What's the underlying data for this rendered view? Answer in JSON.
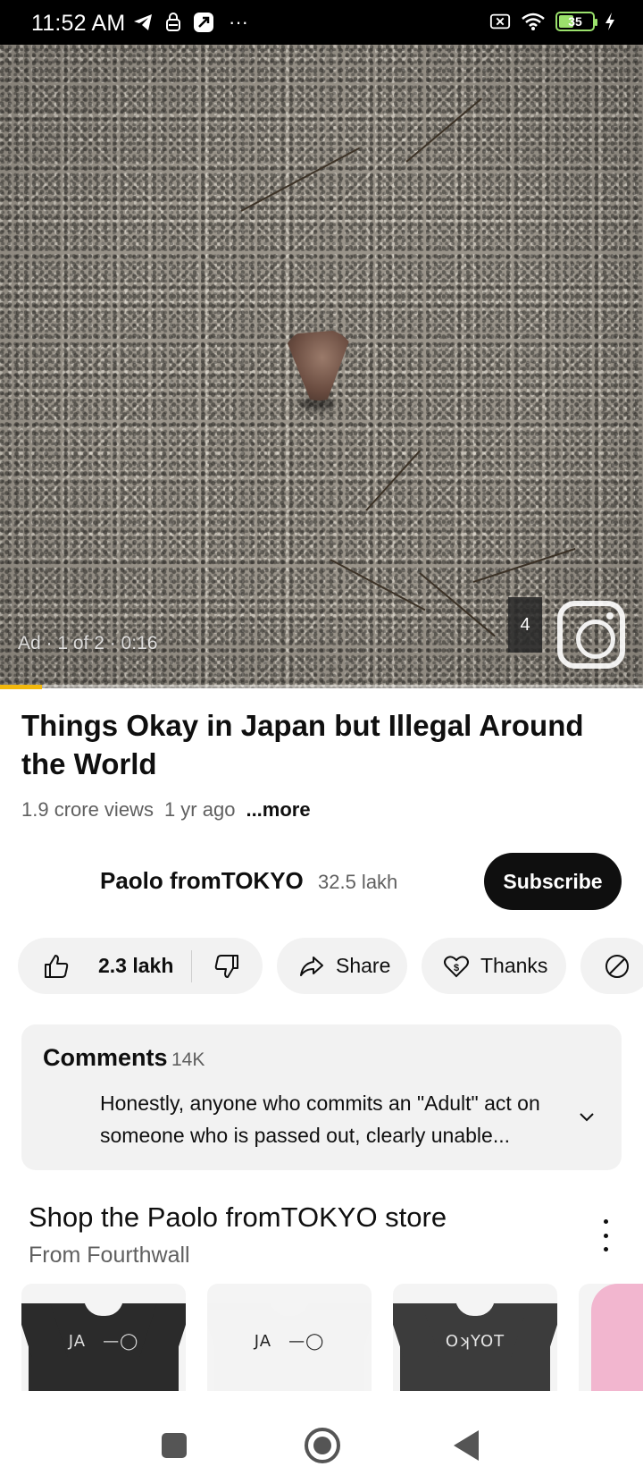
{
  "status_bar": {
    "time": "11:52 AM",
    "more_dots": "···",
    "battery_level": "35",
    "icons": [
      "telegram-icon",
      "vpn-icon",
      "app-icon",
      "no-sim-icon",
      "wifi-icon",
      "battery-icon",
      "charging-icon"
    ]
  },
  "player": {
    "ad_label": "Ad · 1 of 2 · 0:16",
    "skip_countdown": "4",
    "progress_fraction": 0.065,
    "progress_color": "#f2b80c"
  },
  "video": {
    "title": "Things Okay in Japan but Illegal Around the World",
    "views": "1.9 crore views",
    "age": "1 yr ago",
    "more_label": "...more"
  },
  "channel": {
    "name": "Paolo fromTOKYO",
    "subscribers": "32.5 lakh",
    "subscribe_label": "Subscribe"
  },
  "actions": {
    "like_count": "2.3 lakh",
    "share_label": "Share",
    "thanks_label": "Thanks"
  },
  "comments": {
    "heading": "Comments",
    "count": "14K",
    "top_comment": "Honestly, anyone who commits an \"Adult\" act on someone who is passed out, clearly unable..."
  },
  "store": {
    "title": "Shop the Paolo fromTOKYO store",
    "subtitle": "From Fourthwall",
    "products": [
      {
        "print": "JA —◯",
        "shirt_color": "#2b2b2b",
        "print_color": "#dddddd"
      },
      {
        "print": "JA —◯",
        "shirt_color": "#f3f3f3",
        "print_color": "#222222"
      },
      {
        "print": "OʞYOT",
        "shirt_color": "#3c3c3c",
        "print_color": "#e6e6e6"
      }
    ],
    "pink_color": "#f2b6cf"
  }
}
